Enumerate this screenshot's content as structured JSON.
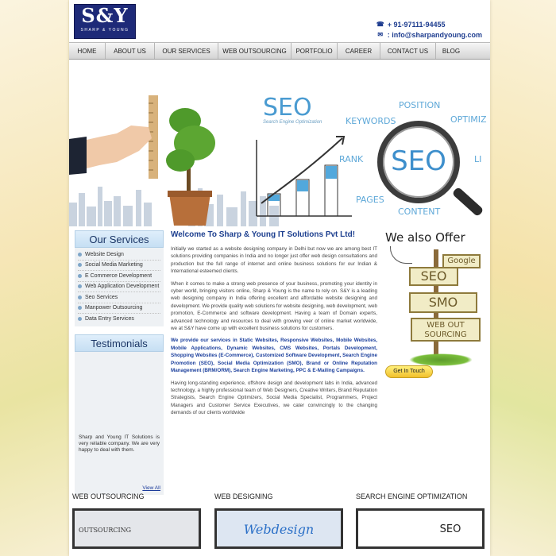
{
  "logo": {
    "text": "S&Y",
    "tagline": "SHARP & YOUNG"
  },
  "contact": {
    "phone": "+ 91-97111-94455",
    "email": ": info@sharpandyoung.com"
  },
  "nav": [
    "HOME",
    "ABOUT US",
    "OUR SERVICES",
    "WEB OUTSOURCING",
    "PORTFOLIO",
    "CAREER",
    "CONTACT US",
    "BLOG"
  ],
  "banner": {
    "seo_title": "SEO",
    "seo_subtitle": "Search Engine Optimization",
    "keywords": {
      "position": "POSITION",
      "keywords": "KEYWORDS",
      "optimize": "OPTIMIZ",
      "rank": "RANK",
      "pages": "PAGES",
      "content": "CONTENT",
      "links": "LI"
    },
    "magnifier": "SEO"
  },
  "sidebar": {
    "services_title": "Our Services",
    "services": [
      "Website Design",
      "Social Media Marketing",
      "E Commerce Development",
      "Web Application Development",
      "Seo Services",
      "Manpower Outsourcing",
      "Data Entry Services"
    ],
    "testimonials_title": "Testimonials",
    "testimonial_text": "Sharp and Young IT Solutions is very reliable company. We are very happy to deal with them.",
    "view_all": "View All"
  },
  "main": {
    "title": "Welcome To Sharp & Young IT Solutions Pvt Ltd!",
    "paragraphs": [
      "Initially we started as a website designing company in Delhi but now we are among best IT solutions providing companies in India and no longer just offer web design consultations and production but the full range of internet and online business solutions for our Indian & International esteemed clients.",
      "When it comes to make a strong web presence of your business, promoting your identity in cyber world, bringing visitors online, Sharp & Young is the name to rely on. S&Y is a leading web designing company in India offering excellent and affordable website designing and development. We provide quality web solutions for website designing, web development, web promotion, E-Commerce and software development. Having a team of Domain experts, advanced technology and resources to deal with growing veer of online market worldwide, we at S&Y have come up with excellent business solutions for customers.",
      "We provide our services in Static Websites, Responsive Websites, Mobile Websites, Mobile Applications, Dynamic Websites, CMS Websites, Portals Development, Shopping Websites (E-Commerce), Customized Software Development, Search Engine Promotion (SEO), Social Media Optimization (SMO), Brand or Online Reputation Management (BRM/ORM), Search Engine Marketing, PPC & E-Mailing Campaigns.",
      "Having long-standing experience, offshore design and development labs in India, advanced technology, a highly professional team of Web Designers, Creative Writers, Brand Reputation Strategists, Search Engine Optimizers, Social Media Specialist, Programmers, Project Managers and Customer Service Executives, we cater convincingly to the changing demands of our clients worldwide"
    ]
  },
  "offer": {
    "title": "We also Offer",
    "signs": [
      "Google",
      "SEO",
      "SMO",
      "WEB OUT SOURCING"
    ],
    "button": "Get In Touch"
  },
  "bottom": [
    {
      "title": "WEB OUTSOURCING",
      "image_text": "OUTSOURCING"
    },
    {
      "title": "WEB DESIGNING",
      "image_text": "Webdesign"
    },
    {
      "title": "SEARCH ENGINE OPTIMIZATION",
      "image_text": "SEO"
    }
  ],
  "colors": {
    "brand_navy": "#1e2a78",
    "link_blue": "#1d3f8f",
    "accent_yellow": "#f2c02c"
  }
}
